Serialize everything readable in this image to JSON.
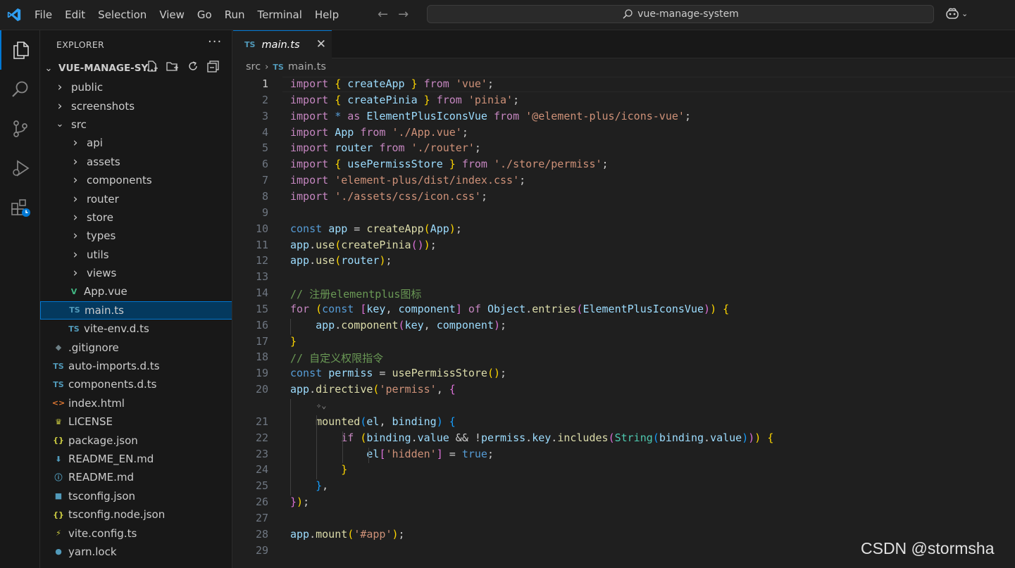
{
  "menu": [
    "File",
    "Edit",
    "Selection",
    "View",
    "Go",
    "Run",
    "Terminal",
    "Help"
  ],
  "search_text": "vue-manage-system",
  "explorer": {
    "title": "EXPLORER",
    "project": "VUE-MANAGE-SY...",
    "tree": [
      {
        "label": "public",
        "depth": 1,
        "kind": "folder",
        "open": false
      },
      {
        "label": "screenshots",
        "depth": 1,
        "kind": "folder",
        "open": false
      },
      {
        "label": "src",
        "depth": 1,
        "kind": "folder",
        "open": true
      },
      {
        "label": "api",
        "depth": 2,
        "kind": "folder",
        "open": false
      },
      {
        "label": "assets",
        "depth": 2,
        "kind": "folder",
        "open": false
      },
      {
        "label": "components",
        "depth": 2,
        "kind": "folder",
        "open": false
      },
      {
        "label": "router",
        "depth": 2,
        "kind": "folder",
        "open": false
      },
      {
        "label": "store",
        "depth": 2,
        "kind": "folder",
        "open": false
      },
      {
        "label": "types",
        "depth": 2,
        "kind": "folder",
        "open": false
      },
      {
        "label": "utils",
        "depth": 2,
        "kind": "folder",
        "open": false
      },
      {
        "label": "views",
        "depth": 2,
        "kind": "folder",
        "open": false
      },
      {
        "label": "App.vue",
        "depth": 2,
        "kind": "vue"
      },
      {
        "label": "main.ts",
        "depth": 2,
        "kind": "ts",
        "selected": true
      },
      {
        "label": "vite-env.d.ts",
        "depth": 2,
        "kind": "ts"
      },
      {
        "label": ".gitignore",
        "depth": 1,
        "kind": "git"
      },
      {
        "label": "auto-imports.d.ts",
        "depth": 1,
        "kind": "ts"
      },
      {
        "label": "components.d.ts",
        "depth": 1,
        "kind": "ts"
      },
      {
        "label": "index.html",
        "depth": 1,
        "kind": "html"
      },
      {
        "label": "LICENSE",
        "depth": 1,
        "kind": "license"
      },
      {
        "label": "package.json",
        "depth": 1,
        "kind": "json"
      },
      {
        "label": "README_EN.md",
        "depth": 1,
        "kind": "md"
      },
      {
        "label": "README.md",
        "depth": 1,
        "kind": "info"
      },
      {
        "label": "tsconfig.json",
        "depth": 1,
        "kind": "tsconfig"
      },
      {
        "label": "tsconfig.node.json",
        "depth": 1,
        "kind": "json"
      },
      {
        "label": "vite.config.ts",
        "depth": 1,
        "kind": "vite"
      },
      {
        "label": "yarn.lock",
        "depth": 1,
        "kind": "yarn"
      }
    ]
  },
  "editor": {
    "tab_badge": "TS",
    "tab_label": "main.ts",
    "breadcrumb": [
      "src",
      "main.ts"
    ],
    "active_line": 1,
    "lines": [
      {
        "n": "1",
        "toks": [
          [
            "import ",
            "kc"
          ],
          [
            "{",
            "b1"
          ],
          [
            " ",
            ""
          ],
          [
            "createApp",
            "v"
          ],
          [
            " ",
            ""
          ],
          [
            "}",
            "b1"
          ],
          [
            " ",
            ""
          ],
          [
            "from",
            "kc"
          ],
          [
            " ",
            ""
          ],
          [
            "'vue'",
            "s"
          ],
          [
            ";",
            ""
          ]
        ]
      },
      {
        "n": "2",
        "toks": [
          [
            "import ",
            "kc"
          ],
          [
            "{",
            "b1"
          ],
          [
            " ",
            ""
          ],
          [
            "createPinia",
            "v"
          ],
          [
            " ",
            ""
          ],
          [
            "}",
            "b1"
          ],
          [
            " ",
            ""
          ],
          [
            "from",
            "kc"
          ],
          [
            " ",
            ""
          ],
          [
            "'pinia'",
            "s"
          ],
          [
            ";",
            ""
          ]
        ]
      },
      {
        "n": "3",
        "toks": [
          [
            "import ",
            "kc"
          ],
          [
            "* ",
            "k"
          ],
          [
            "as ",
            "kc"
          ],
          [
            "ElementPlusIconsVue",
            "v"
          ],
          [
            " from ",
            "kc"
          ],
          [
            "'@element-plus/icons-vue'",
            "s"
          ],
          [
            ";",
            ""
          ]
        ]
      },
      {
        "n": "4",
        "toks": [
          [
            "import ",
            "kc"
          ],
          [
            "App",
            "v"
          ],
          [
            " from ",
            "kc"
          ],
          [
            "'./App.vue'",
            "s"
          ],
          [
            ";",
            ""
          ]
        ]
      },
      {
        "n": "5",
        "toks": [
          [
            "import ",
            "kc"
          ],
          [
            "router",
            "v"
          ],
          [
            " from ",
            "kc"
          ],
          [
            "'./router'",
            "s"
          ],
          [
            ";",
            ""
          ]
        ]
      },
      {
        "n": "6",
        "toks": [
          [
            "import ",
            "kc"
          ],
          [
            "{",
            "b1"
          ],
          [
            " ",
            ""
          ],
          [
            "usePermissStore",
            "v"
          ],
          [
            " ",
            ""
          ],
          [
            "}",
            "b1"
          ],
          [
            " from ",
            "kc"
          ],
          [
            "'./store/permiss'",
            "s"
          ],
          [
            ";",
            ""
          ]
        ]
      },
      {
        "n": "7",
        "toks": [
          [
            "import ",
            "kc"
          ],
          [
            "'element-plus/dist/index.css'",
            "s"
          ],
          [
            ";",
            ""
          ]
        ]
      },
      {
        "n": "8",
        "toks": [
          [
            "import ",
            "kc"
          ],
          [
            "'./assets/css/icon.css'",
            "s"
          ],
          [
            ";",
            ""
          ]
        ]
      },
      {
        "n": "9",
        "toks": []
      },
      {
        "n": "10",
        "toks": [
          [
            "const ",
            "k"
          ],
          [
            "app",
            "v"
          ],
          [
            " = ",
            ""
          ],
          [
            "createApp",
            "f"
          ],
          [
            "(",
            "b1"
          ],
          [
            "App",
            "v"
          ],
          [
            ")",
            "b1"
          ],
          [
            ";",
            ""
          ]
        ]
      },
      {
        "n": "11",
        "toks": [
          [
            "app",
            "v"
          ],
          [
            ".",
            ""
          ],
          [
            "use",
            "f"
          ],
          [
            "(",
            "b1"
          ],
          [
            "createPinia",
            "f"
          ],
          [
            "()",
            "b2"
          ],
          [
            ")",
            "b1"
          ],
          [
            ";",
            ""
          ]
        ]
      },
      {
        "n": "12",
        "toks": [
          [
            "app",
            "v"
          ],
          [
            ".",
            ""
          ],
          [
            "use",
            "f"
          ],
          [
            "(",
            "b1"
          ],
          [
            "router",
            "v"
          ],
          [
            ")",
            "b1"
          ],
          [
            ";",
            ""
          ]
        ]
      },
      {
        "n": "13",
        "toks": []
      },
      {
        "n": "14",
        "toks": [
          [
            "// 注册elementplus图标",
            "c"
          ]
        ]
      },
      {
        "n": "15",
        "toks": [
          [
            "for ",
            "kc"
          ],
          [
            "(",
            "b1"
          ],
          [
            "const ",
            "k"
          ],
          [
            "[",
            "b2"
          ],
          [
            "key",
            "v"
          ],
          [
            ", ",
            ""
          ],
          [
            "component",
            "v"
          ],
          [
            "]",
            "b2"
          ],
          [
            " of ",
            "kc"
          ],
          [
            "Object",
            "v"
          ],
          [
            ".",
            ""
          ],
          [
            "entries",
            "f"
          ],
          [
            "(",
            "b2"
          ],
          [
            "ElementPlusIconsVue",
            "v"
          ],
          [
            ")",
            "b2"
          ],
          [
            ")",
            "b1"
          ],
          [
            " ",
            ""
          ],
          [
            "{",
            "b1"
          ]
        ]
      },
      {
        "n": "16",
        "toks": [
          [
            "    ",
            ""
          ],
          [
            "app",
            "v"
          ],
          [
            ".",
            ""
          ],
          [
            "component",
            "f"
          ],
          [
            "(",
            "b2"
          ],
          [
            "key",
            "v"
          ],
          [
            ", ",
            ""
          ],
          [
            "component",
            "v"
          ],
          [
            ")",
            "b2"
          ],
          [
            ";",
            ""
          ]
        ]
      },
      {
        "n": "17",
        "toks": [
          [
            "}",
            "b1"
          ]
        ]
      },
      {
        "n": "18",
        "toks": [
          [
            "// 自定义权限指令",
            "c"
          ]
        ]
      },
      {
        "n": "19",
        "toks": [
          [
            "const ",
            "k"
          ],
          [
            "permiss",
            "v"
          ],
          [
            " = ",
            ""
          ],
          [
            "usePermissStore",
            "f"
          ],
          [
            "()",
            "b1"
          ],
          [
            ";",
            ""
          ]
        ]
      },
      {
        "n": "20",
        "toks": [
          [
            "app",
            "v"
          ],
          [
            ".",
            ""
          ],
          [
            "directive",
            "f"
          ],
          [
            "(",
            "b1"
          ],
          [
            "'permiss'",
            "s"
          ],
          [
            ", ",
            ""
          ],
          [
            "{",
            "b2"
          ]
        ]
      },
      {
        "n": "",
        "toks": [],
        "lens": true
      },
      {
        "n": "21",
        "toks": [
          [
            "    ",
            ""
          ],
          [
            "mounted",
            "f"
          ],
          [
            "(",
            "b3"
          ],
          [
            "el",
            "v"
          ],
          [
            ", ",
            ""
          ],
          [
            "binding",
            "v"
          ],
          [
            ")",
            "b3"
          ],
          [
            " ",
            ""
          ],
          [
            "{",
            "b3"
          ]
        ]
      },
      {
        "n": "22",
        "toks": [
          [
            "        ",
            ""
          ],
          [
            "if ",
            "kc"
          ],
          [
            "(",
            "b1"
          ],
          [
            "binding",
            "v"
          ],
          [
            ".",
            ""
          ],
          [
            "value",
            "v"
          ],
          [
            " && !",
            ""
          ],
          [
            "permiss",
            "v"
          ],
          [
            ".",
            ""
          ],
          [
            "key",
            "v"
          ],
          [
            ".",
            ""
          ],
          [
            "includes",
            "f"
          ],
          [
            "(",
            "b2"
          ],
          [
            "String",
            "t"
          ],
          [
            "(",
            "b3"
          ],
          [
            "binding",
            "v"
          ],
          [
            ".",
            ""
          ],
          [
            "value",
            "v"
          ],
          [
            ")",
            "b3"
          ],
          [
            ")",
            "b2"
          ],
          [
            ")",
            "b1"
          ],
          [
            " ",
            ""
          ],
          [
            "{",
            "b1"
          ]
        ]
      },
      {
        "n": "23",
        "toks": [
          [
            "            ",
            ""
          ],
          [
            "el",
            "v"
          ],
          [
            "[",
            "b2"
          ],
          [
            "'hidden'",
            "s"
          ],
          [
            "]",
            "b2"
          ],
          [
            " = ",
            ""
          ],
          [
            "true",
            "k"
          ],
          [
            ";",
            ""
          ]
        ]
      },
      {
        "n": "24",
        "toks": [
          [
            "        ",
            ""
          ],
          [
            "}",
            "b1"
          ]
        ]
      },
      {
        "n": "25",
        "toks": [
          [
            "    ",
            ""
          ],
          [
            "}",
            "b3"
          ],
          [
            ",",
            ""
          ]
        ]
      },
      {
        "n": "26",
        "toks": [
          [
            "}",
            "b2"
          ],
          [
            ")",
            "b1"
          ],
          [
            ";",
            ""
          ]
        ]
      },
      {
        "n": "27",
        "toks": []
      },
      {
        "n": "28",
        "toks": [
          [
            "app",
            "v"
          ],
          [
            ".",
            ""
          ],
          [
            "mount",
            "f"
          ],
          [
            "(",
            "b1"
          ],
          [
            "'#app'",
            "s"
          ],
          [
            ")",
            "b1"
          ],
          [
            ";",
            ""
          ]
        ]
      },
      {
        "n": "29",
        "toks": []
      }
    ]
  },
  "watermark": "CSDN @stormsha"
}
